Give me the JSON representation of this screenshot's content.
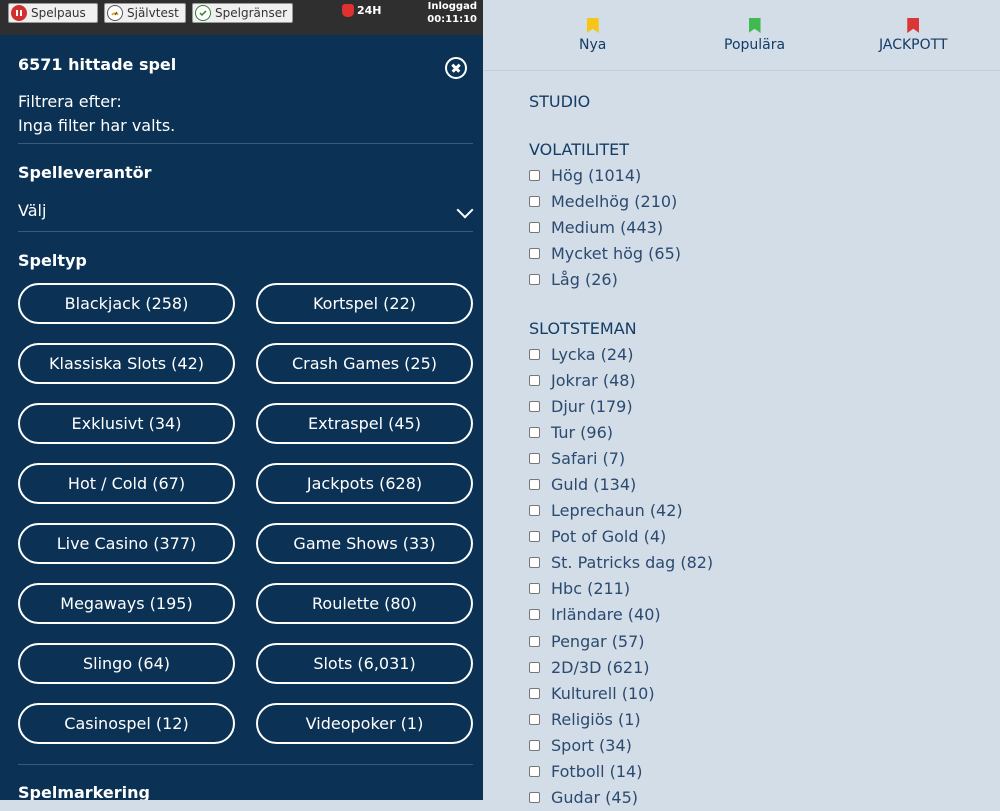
{
  "topbar": {
    "spelpaus": "Spelpaus",
    "sjalvtest": "Självtest",
    "spelgranser": "Spelgränser",
    "limit24": "24H",
    "login_label": "Inloggad",
    "login_time": "00:11:10"
  },
  "filter_panel": {
    "found": "6571 hittade spel",
    "filter_heading": "Filtrera efter:",
    "filter_status": "Inga filter har valts.",
    "provider_heading": "Spelleverantör",
    "provider_select": "Välj",
    "type_heading": "Speltyp",
    "game_types": [
      "Blackjack (258)",
      "Kortspel (22)",
      "Klassiska Slots (42)",
      "Crash Games (25)",
      "Exklusivt (34)",
      "Extraspel (45)",
      "Hot / Cold (67)",
      "Jackpots (628)",
      "Live Casino (377)",
      "Game Shows (33)",
      "Megaways (195)",
      "Roulette (80)",
      "Slingo (64)",
      "Slots (6,031)",
      "Casinospel (12)",
      "Videopoker (1)"
    ],
    "marking_heading": "Spelmarkering"
  },
  "tabs": [
    {
      "label": "Nya",
      "color": "#f5c518"
    },
    {
      "label": "Populära",
      "color": "#3fb950"
    },
    {
      "label": "JACKPOTT",
      "color": "#d93636"
    }
  ],
  "studio_heading": "STUDIO",
  "volatility": {
    "heading": "VOLATILITET",
    "items": [
      "Hög (1014)",
      "Medelhög (210)",
      "Medium (443)",
      "Mycket hög (65)",
      "Låg (26)"
    ]
  },
  "themes": {
    "heading": "SLOTSTEMAN",
    "items": [
      "Lycka (24)",
      "Jokrar (48)",
      "Djur (179)",
      "Tur (96)",
      "Safari (7)",
      "Guld (134)",
      "Leprechaun (42)",
      "Pot of Gold (4)",
      "St. Patricks dag (82)",
      "Hbc (211)",
      "Irländare (40)",
      "Pengar (57)",
      "2D/3D (621)",
      "Kulturell (10)",
      "Religiös (1)",
      "Sport (34)",
      "Fotboll (14)",
      "Gudar (45)"
    ]
  }
}
